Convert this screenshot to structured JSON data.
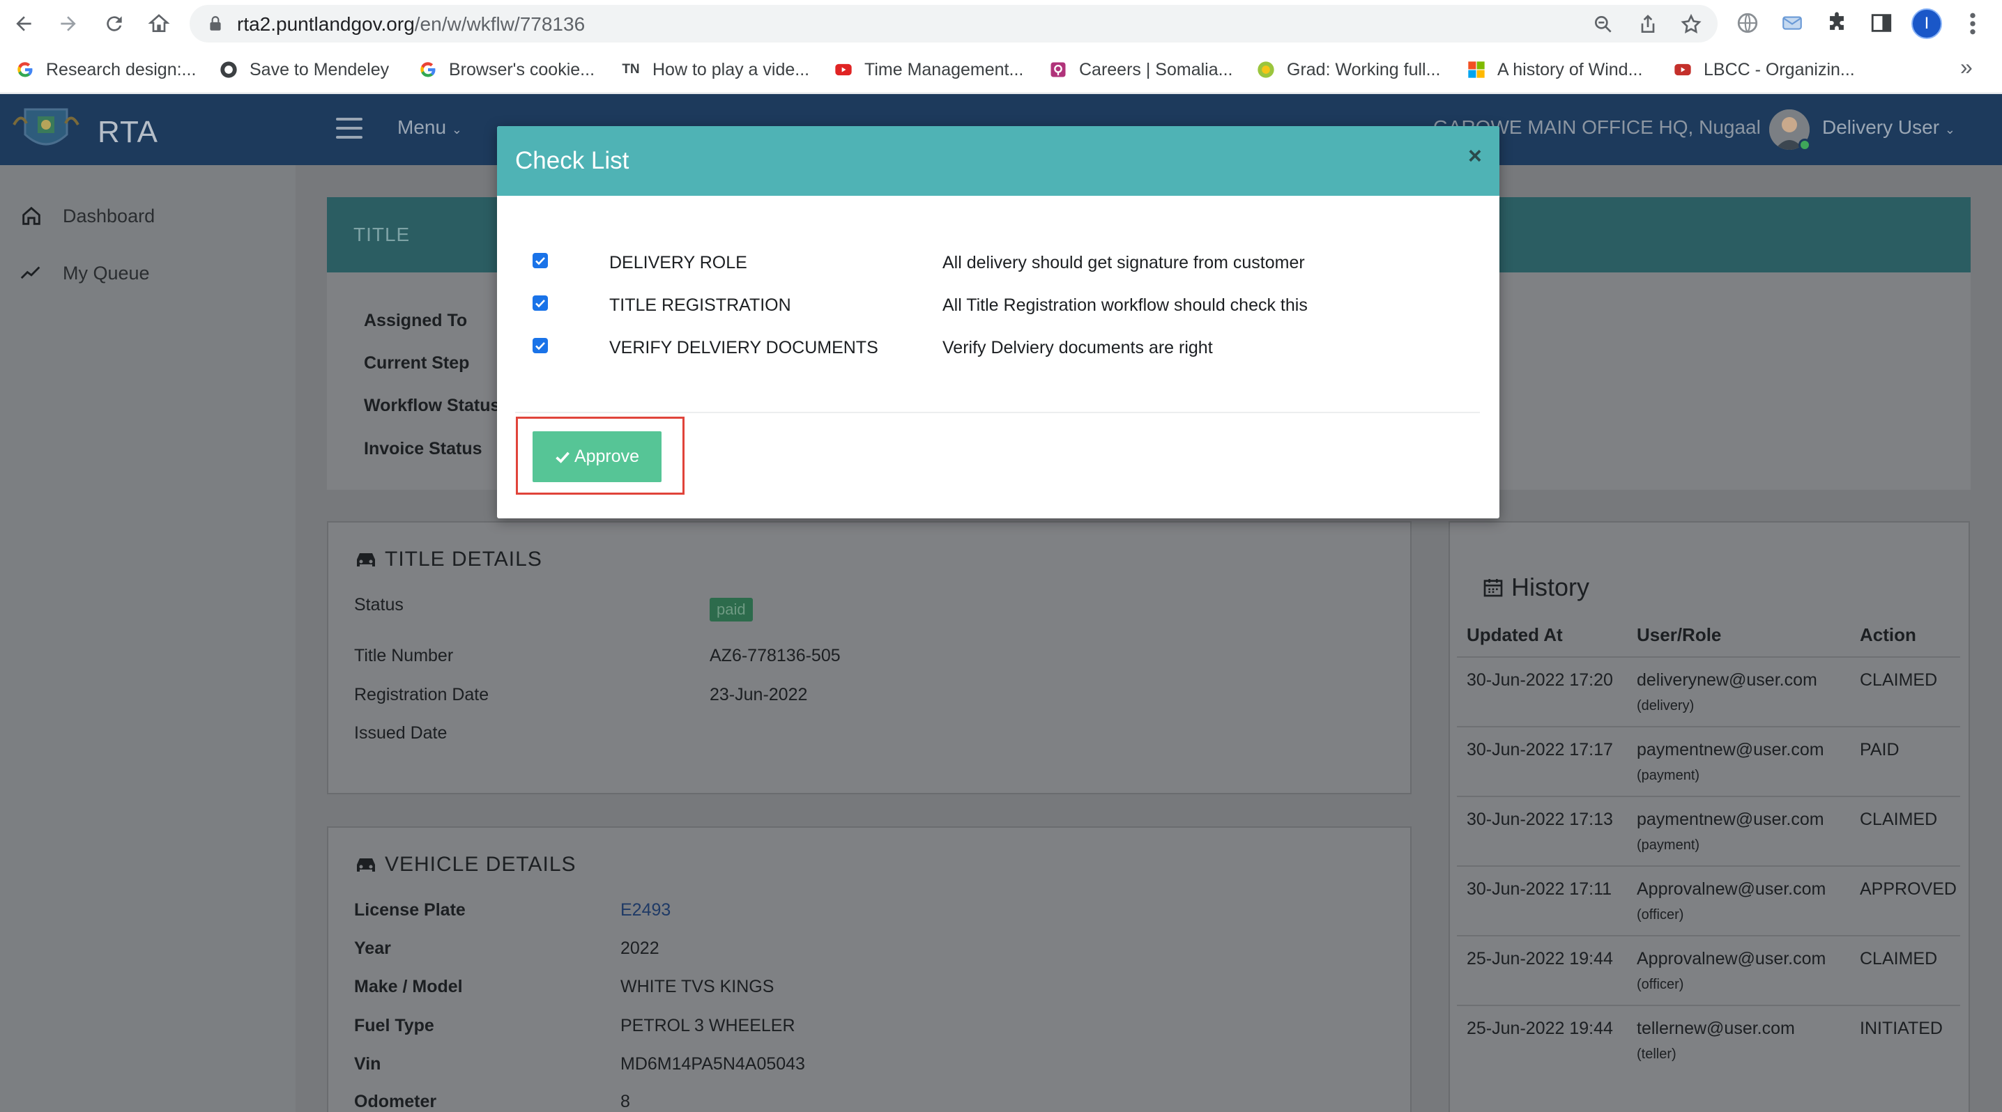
{
  "browser": {
    "url_host": "rta2.puntlandgov.org",
    "url_path": "/en/w/wkflw/778136",
    "profile_initial": "I",
    "bookmarks": [
      {
        "label": "Research design:...",
        "icon": "google-icon"
      },
      {
        "label": "Save to Mendeley",
        "icon": "mendeley-icon"
      },
      {
        "label": "Browser's cookie...",
        "icon": "google-icon"
      },
      {
        "label": "How to play a vide...",
        "icon": "tn-icon",
        "icon_text": "TN"
      },
      {
        "label": "Time Management...",
        "icon": "youtube-icon"
      },
      {
        "label": "Careers | Somalia...",
        "icon": "careers-icon"
      },
      {
        "label": "Grad: Working full...",
        "icon": "grad-icon"
      },
      {
        "label": "A history of Wind...",
        "icon": "windows-icon"
      },
      {
        "label": "LBCC - Organizin...",
        "icon": "youtube-icon"
      }
    ],
    "more": "»"
  },
  "app": {
    "brand": "RTA",
    "menu_label": "Menu",
    "office": "GAROWE MAIN OFFICE HQ, Nugaal",
    "user_name": "Delivery User"
  },
  "sidebar": {
    "items": [
      {
        "label": "Dashboard",
        "icon": "home-icon"
      },
      {
        "label": "My Queue",
        "icon": "trend-icon"
      }
    ]
  },
  "title_panel": {
    "heading": "TITLE",
    "fields": [
      "Assigned To",
      "Current Step",
      "Workflow Status",
      "Invoice Status"
    ]
  },
  "title_details": {
    "heading": "TITLE DETAILS",
    "status_label": "Status",
    "status_badge": "paid",
    "rows": [
      {
        "label": "Title Number",
        "value": "AZ6-778136-505"
      },
      {
        "label": "Registration Date",
        "value": "23-Jun-2022"
      },
      {
        "label": "Issued Date",
        "value": ""
      }
    ]
  },
  "vehicle_details": {
    "heading": "VEHICLE DETAILS",
    "rows": [
      {
        "label": "License Plate",
        "value": "E2493"
      },
      {
        "label": "Year",
        "value": "2022"
      },
      {
        "label": "Make / Model",
        "value": "WHITE TVS KINGS"
      },
      {
        "label": "Fuel Type",
        "value": "PETROL 3 WHEELER"
      },
      {
        "label": "Vin",
        "value": "MD6M14PA5N4A05043"
      },
      {
        "label": "Odometer",
        "value": "8"
      }
    ]
  },
  "history": {
    "heading": "History",
    "columns": [
      "Updated At",
      "User/Role",
      "Action"
    ],
    "rows": [
      {
        "updated": "30-Jun-2022 17:20",
        "user": "deliverynew@user.com",
        "role": "(delivery)",
        "action": "CLAIMED"
      },
      {
        "updated": "30-Jun-2022 17:17",
        "user": "paymentnew@user.com",
        "role": "(payment)",
        "action": "PAID"
      },
      {
        "updated": "30-Jun-2022 17:13",
        "user": "paymentnew@user.com",
        "role": "(payment)",
        "action": "CLAIMED"
      },
      {
        "updated": "30-Jun-2022 17:11",
        "user": "Approvalnew@user.com",
        "role": "(officer)",
        "action": "APPROVED"
      },
      {
        "updated": "25-Jun-2022 19:44",
        "user": "Approvalnew@user.com",
        "role": "(officer)",
        "action": "CLAIMED"
      },
      {
        "updated": "25-Jun-2022 19:44",
        "user": "tellernew@user.com",
        "role": "(teller)",
        "action": "INITIATED"
      }
    ]
  },
  "modal": {
    "title": "Check List",
    "close": "×",
    "items": [
      {
        "role": "DELIVERY ROLE",
        "description": "All delivery should get signature from customer",
        "checked": true
      },
      {
        "role": "TITLE REGISTRATION",
        "description": "All Title Registration workflow should check this",
        "checked": true
      },
      {
        "role": "VERIFY DELVIERY DOCUMENTS",
        "description": "Verify Delviery documents are right",
        "checked": true
      }
    ],
    "approve_label": "Approve"
  },
  "colors": {
    "modal_header": "#4fb3b5",
    "approve_button": "#56c596",
    "highlight_border": "#e0443b",
    "topbar": "#1d3a5c"
  }
}
